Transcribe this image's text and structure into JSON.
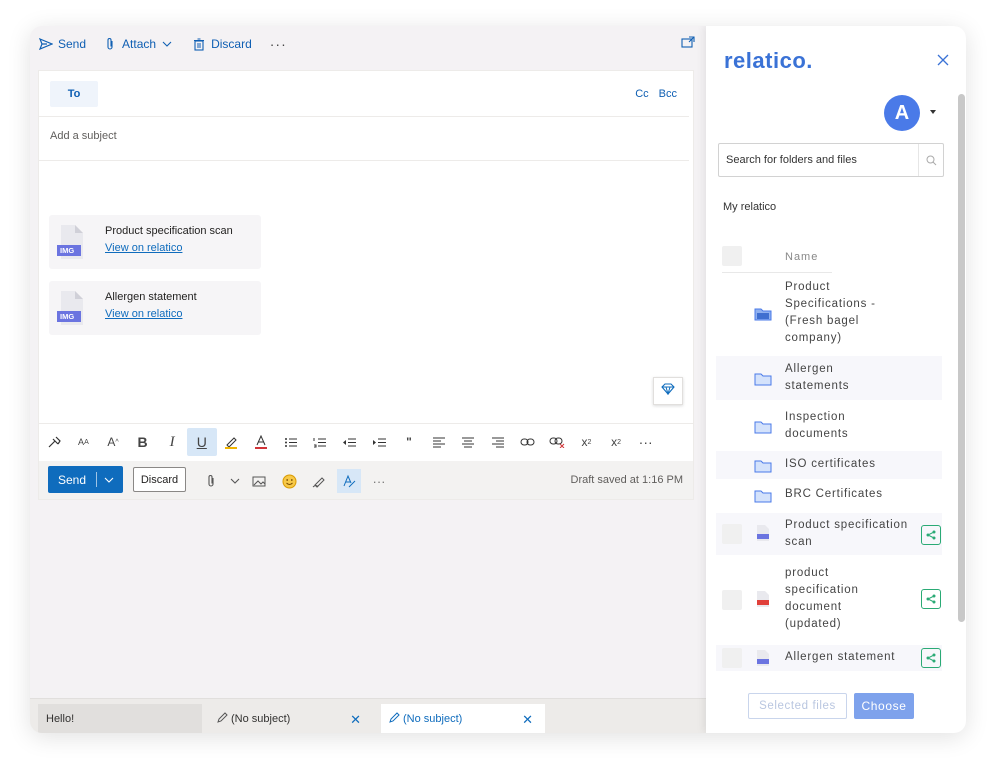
{
  "cmdbar": {
    "send": "Send",
    "attach": "Attach",
    "discard": "Discard",
    "more": "···"
  },
  "compose": {
    "to_label": "To",
    "cc": "Cc",
    "bcc": "Bcc",
    "subject_placeholder": "Add a subject",
    "attachments": [
      {
        "type_label": "IMG",
        "title": "Product specification scan",
        "link": "View on relatico"
      },
      {
        "type_label": "IMG",
        "title": "Allergen statement",
        "link": "View on relatico"
      }
    ],
    "format_tools": [
      "format-painter-icon",
      "font-size-icon",
      "grow-font-icon",
      "bold-icon",
      "italic-icon",
      "underline-icon",
      "highlight-icon",
      "font-color-icon",
      "bullets-icon",
      "numbering-icon",
      "decrease-indent-icon",
      "increase-indent-icon",
      "quote-icon",
      "align-left-icon",
      "align-center-icon",
      "align-right-icon",
      "link-icon",
      "unlink-icon",
      "superscript-icon",
      "subscript-icon",
      "more-icon"
    ],
    "send_button": "Send",
    "discard_button": "Discard",
    "draft_status": "Draft saved at 1:16 PM"
  },
  "tabs": [
    {
      "label": "Hello!"
    },
    {
      "label": "(No subject)"
    },
    {
      "label": "(No subject)"
    }
  ],
  "panel": {
    "logo": "relatico.",
    "avatar_initial": "A",
    "search_placeholder": "Search for folders and files",
    "section": "My relatico",
    "name_header": "Name",
    "items": [
      {
        "name": "Product Specifications - (Fresh bagel company)",
        "kind": "shared-folder"
      },
      {
        "name": "Allergen statements",
        "kind": "folder"
      },
      {
        "name": "Inspection documents",
        "kind": "folder"
      },
      {
        "name": "ISO certificates",
        "kind": "folder"
      },
      {
        "name": "BRC Certificates",
        "kind": "folder"
      },
      {
        "name": "Product specification scan",
        "kind": "img-file"
      },
      {
        "name": "product specification document (updated)",
        "kind": "pdf-file"
      },
      {
        "name": "Allergen statement",
        "kind": "img-file"
      }
    ],
    "selected_files": "Selected files",
    "choose": "Choose"
  },
  "colors": {
    "accent": "#0f6cbd",
    "brand": "#3a72d6",
    "share": "#2aaa75"
  }
}
